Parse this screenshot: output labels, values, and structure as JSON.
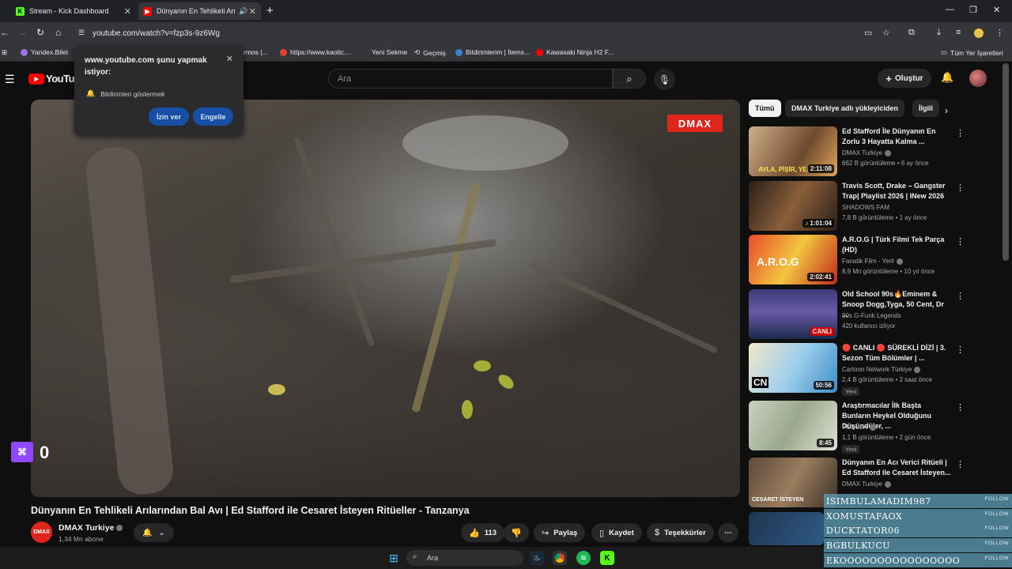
{
  "browser": {
    "tabs": [
      {
        "title": "Stream - Kick Dashboard",
        "active": false
      },
      {
        "title": "Dünyanın En Tehlikeli Arıları",
        "active": true
      }
    ],
    "url": "youtube.com/watch?v=fzp3s-9z6Wg",
    "bookmarks": [
      "Yandex.Bilet",
      "https://www.kaotic....",
      "Yeni Sekme",
      "Geçmiş",
      "Bildirimlerim | İtems...",
      "Kawasaki Ninja H2 F...",
      "Tüm Yer İşaretleri"
    ],
    "bookmark_partial": "rmos |..."
  },
  "permission_popup": {
    "title": "www.youtube.com şunu yapmak istiyor:",
    "permission": "Bildirimleri göstermek",
    "allow_label": "İzin ver",
    "block_label": "Engelle"
  },
  "youtube": {
    "logo": "YouTube",
    "search_placeholder": "Ara",
    "create_label": "Oluştur"
  },
  "video": {
    "brand_logo": "DMAX",
    "twitch_count": "0",
    "title": "Dünyanın En Tehlikeli Arılarından Bal Avı | Ed Stafford ile Cesaret İsteyen Ritüeller - Tanzanya",
    "channel": "DMAX Turkiye",
    "channel_avatar": "DMAX",
    "subscribers": "1,34 Mn abone",
    "likes": "113",
    "share_label": "Paylaş",
    "save_label": "Kaydet",
    "thanks_label": "Teşekkürler"
  },
  "chips": [
    "Tümü",
    "DMAX Turkiye adlı yükleyiciden",
    "İlgili"
  ],
  "recommendations": [
    {
      "title": "Ed Stafford İle Dünyanın En Zorlu 3 Hayatta Kalma ...",
      "channel": "DMAX Turkiye",
      "verified": true,
      "meta": "662 B görüntüleme • 6 ay önce",
      "duration": "2:11:08",
      "new": "",
      "thumb_text": "AVLA, PİŞİR, YE."
    },
    {
      "title": "Travis Scott, Drake – Gangster Trap| Playlist 2026 | INew 2026",
      "channel": "SHADOWS FAM",
      "verified": false,
      "meta": "7,8 B görüntüleme • 1 ay önce",
      "duration": "♪ 1:01:04",
      "new": "",
      "thumb_text": ""
    },
    {
      "title": "A.R.O.G | Türk Filmi Tek Parça (HD)",
      "channel": "Fanatik Film - Yerli",
      "verified": true,
      "meta": "8,9 Mn görüntüleme • 10 yıl önce",
      "duration": "2:02:41",
      "new": "",
      "thumb_text": "A.R.O.G"
    },
    {
      "title": "Old School 90s🔥Eminem & Snoop Dogg,Tyga, 50 Cent, Dr ...",
      "channel": "90s G-Funk Legends",
      "verified": false,
      "meta": "420 kullanıcı izliyor",
      "duration": "CANLI",
      "new": "",
      "thumb_text": ""
    },
    {
      "title": "🔴 CANLI 🔴 SÜREKLİ DİZİ | 3. Sezon Tüm Bölümler | ...",
      "channel": "Cartoon Network Türkiye",
      "verified": true,
      "meta": "2,4 B görüntüleme • 2 saat önce",
      "duration": "50:56",
      "new": "Yeni",
      "thumb_text": "CN"
    },
    {
      "title": "Araştırmacılar İlk Başta Bunların Heykel Olduğunu Düşündüler, ...",
      "channel": "PUSULA",
      "verified": true,
      "meta": "1,1 B görüntüleme • 2 gün önce",
      "duration": "8:45",
      "new": "Yeni",
      "thumb_text": ""
    },
    {
      "title": "Dünyanın En Acı Verici Ritüeli | Ed Stafford ile Cesaret İsteyen...",
      "channel": "DMAX Turkiye",
      "verified": true,
      "meta": "",
      "duration": "",
      "new": "",
      "thumb_text": "CESARET İSTEYEN"
    }
  ],
  "overlay_follows": [
    {
      "name": "ISIMBULAMADIM987",
      "tag": "FOLLOW"
    },
    {
      "name": "XOMUSTAFAOX",
      "tag": "FOLLOW"
    },
    {
      "name": "DUCKTATOR06",
      "tag": "FOLLOW"
    },
    {
      "name": "BGBULKUCU",
      "tag": "FOLLOW"
    },
    {
      "name": "EKOOOOOOOOOOOOOOOO",
      "tag": "FOLLOW"
    }
  ],
  "taskbar": {
    "search_placeholder": "Ara"
  },
  "colors": {
    "yt_red": "#ff0000",
    "dmax_red": "#e0261c",
    "popup_button": "#174ea6",
    "twitch_purple": "#9146ff"
  }
}
